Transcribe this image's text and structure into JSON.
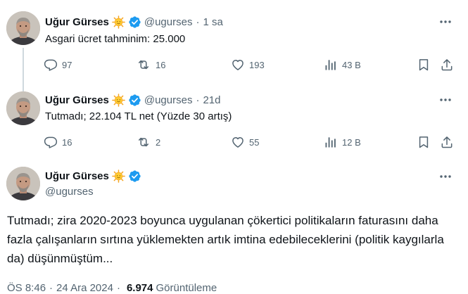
{
  "tweets": [
    {
      "name": "Uğur Gürses",
      "handle": "@ugurses",
      "separator": "·",
      "time": "1 sa",
      "text": "Asgari ücret tahminim: 25.000",
      "replies": "97",
      "retweets": "16",
      "likes": "193",
      "views": "43 B"
    },
    {
      "name": "Uğur Gürses",
      "handle": "@ugurses",
      "separator": "·",
      "time": "21d",
      "text": "Tutmadı; 22.104 TL net (Yüzde 30 artış)",
      "replies": "16",
      "retweets": "2",
      "likes": "55",
      "views": "12 B"
    }
  ],
  "main": {
    "name": "Uğur Gürses",
    "handle": "@ugurses",
    "text": "Tutmadı; zira 2020-2023 boyunca uygulanan çökertici politikaların faturasını daha fazla çalışanların sırtına yüklemekten artık imtina edebileceklerini (politik kaygılarla da) düşünmüştüm...",
    "time": "ÖS 8:46",
    "separator": "·",
    "date": "24 Ara 2024",
    "views_count": "6.974",
    "views_label": "Görüntüleme"
  },
  "colors": {
    "text": "#0f1419",
    "secondary": "#536471",
    "verified": "#1d9bf0",
    "thread_line": "#cfd9de"
  }
}
